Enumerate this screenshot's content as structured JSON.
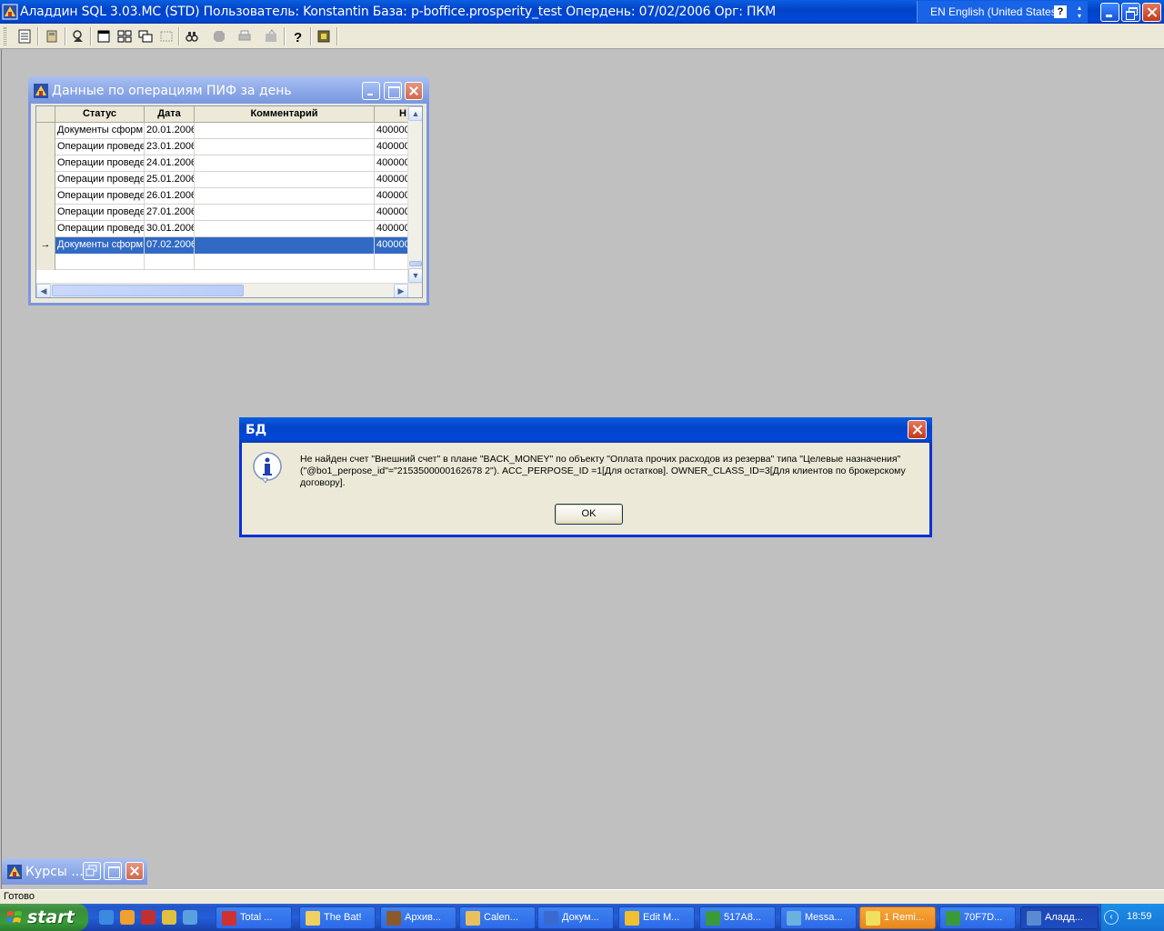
{
  "app": {
    "title": "Аладдин SQL 3.03.MC (STD)  Пользователь: Konstantin База: p-boffice.prosperity_test Опердень: 07/02/2006 Орг: ПКМ",
    "language": "EN English (United States)",
    "help_glyph": "?"
  },
  "child_window": {
    "title": "Данные по операциям ПИФ за день",
    "columns": [
      "Статус",
      "Дата",
      "Комментарий",
      "Н"
    ],
    "rows": [
      {
        "status": "Документы сформ",
        "date": "20.01.2006",
        "comment": "",
        "num": "400000"
      },
      {
        "status": "Операции проведе",
        "date": "23.01.2006",
        "comment": "",
        "num": "400000"
      },
      {
        "status": "Операции проведе",
        "date": "24.01.2006",
        "comment": "",
        "num": "400000"
      },
      {
        "status": "Операции проведе",
        "date": "25.01.2006",
        "comment": "",
        "num": "400000"
      },
      {
        "status": "Операции проведе",
        "date": "26.01.2006",
        "comment": "",
        "num": "400000"
      },
      {
        "status": "Операции проведе",
        "date": "27.01.2006",
        "comment": "",
        "num": "400000"
      },
      {
        "status": "Операции проведе",
        "date": "30.01.2006",
        "comment": "",
        "num": "400000"
      },
      {
        "status": "Документы сформ",
        "date": "07.02.2006",
        "comment": "",
        "num": "400000"
      },
      {
        "status": "",
        "date": "",
        "comment": "",
        "num": ""
      }
    ],
    "selected_row": 7,
    "row_indicator": "→"
  },
  "dialog": {
    "title": "БД",
    "message": "Не найден счет \"Внешний счет\" в плане \"BACK_MONEY\" по объекту \"Оплата прочих расходов из резерва\" типа \"Целевые назначения\" (\"@bo1_perpose_id\"=\"2153500000162678 2\"). ACC_PERPOSE_ID =1[Для остатков]. OWNER_CLASS_ID=3[Для клиентов по брокерскому договору].",
    "ok_label": "OK"
  },
  "minimized_window": {
    "title": "Курсы ..."
  },
  "status_bar": {
    "text": "Готово"
  },
  "taskbar": {
    "start_label": "start",
    "tasks": [
      {
        "label": "Total ...",
        "icon": "total-commander-icon",
        "color": "#d03030"
      },
      {
        "label": "The Bat!",
        "icon": "the-bat-icon",
        "color": "#f0d060"
      },
      {
        "label": "Архив...",
        "icon": "archive-icon",
        "color": "#8a5a2a"
      },
      {
        "label": "Calen...",
        "icon": "calendar-icon",
        "color": "#e8c060"
      },
      {
        "label": "Докум...",
        "icon": "document-icon",
        "color": "#3a6ad0"
      },
      {
        "label": "Edit M...",
        "icon": "edit-icon",
        "color": "#f0c030"
      },
      {
        "label": "517A8...",
        "icon": "excel-icon",
        "color": "#3a9a3a"
      },
      {
        "label": "Messa...",
        "icon": "message-icon",
        "color": "#6ab0e0"
      },
      {
        "label": "1 Remi...",
        "icon": "reminder-icon",
        "color": "#f0e060"
      },
      {
        "label": "70F7D...",
        "icon": "excel-icon",
        "color": "#3a9a3a"
      },
      {
        "label": "Аладд...",
        "icon": "aladdin-icon",
        "color": "#5a8ad0"
      }
    ],
    "clock": "18:59"
  }
}
